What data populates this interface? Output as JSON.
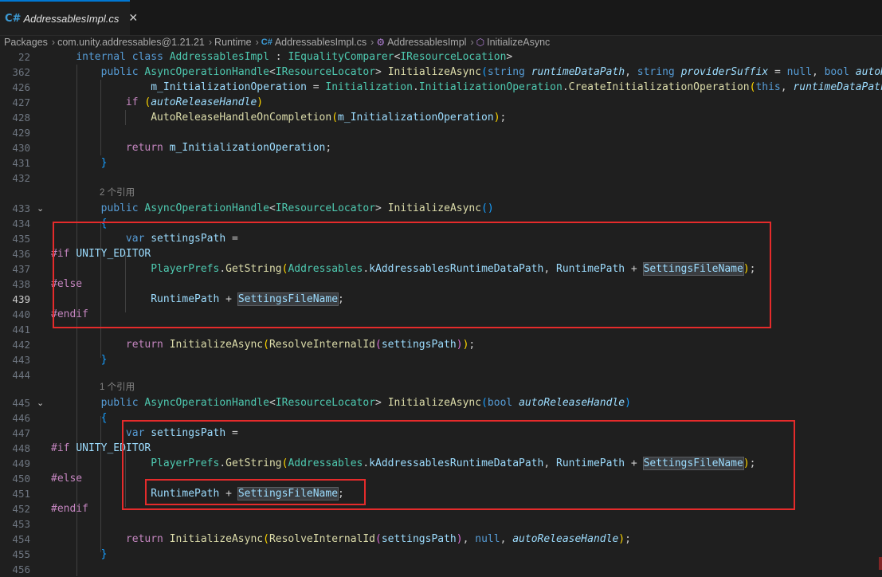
{
  "tab": {
    "icon": "C#",
    "title": "AddressablesImpl.cs",
    "close": "✕"
  },
  "breadcrumb": {
    "items": [
      "Packages",
      "com.unity.addressables@1.21.21",
      "Runtime",
      "AddressablesImpl.cs",
      "AddressablesImpl",
      "InitializeAsync"
    ],
    "separator": "›"
  },
  "code": {
    "ln": {
      "l22": "22",
      "l362": "362",
      "l426": "426",
      "l427": "427",
      "l428": "428",
      "l429": "429",
      "l430": "430",
      "l431": "431",
      "l432": "432",
      "l433": "433",
      "l434": "434",
      "l435": "435",
      "l436": "436",
      "l437": "437",
      "l438": "438",
      "l439": "439",
      "l440": "440",
      "l441": "441",
      "l442": "442",
      "l443": "443",
      "l444": "444",
      "l445": "445",
      "l446": "446",
      "l447": "447",
      "l448": "448",
      "l449": "449",
      "l450": "450",
      "l451": "451",
      "l452": "452",
      "l453": "453",
      "l454": "454",
      "l455": "455",
      "l456": "456"
    },
    "lens1": "2 个引用",
    "lens2": "1 个引用",
    "t": {
      "internal": "internal",
      "class": "class",
      "public": "public",
      "string": "string",
      "null": "null",
      "bool": "bool",
      "this": "this",
      "if": "if",
      "return": "return",
      "var": "var",
      "pp_if": "#if",
      "pp_else": "#else",
      "pp_endif": "#endif",
      "UNITY_EDITOR": "UNITY_EDITOR",
      "AddressablesImpl": "AddressablesImpl",
      "IEqualityComparer": "IEqualityComparer",
      "IResourceLocation": "IResourceLocation",
      "AsyncOperationHandle": "AsyncOperationHandle",
      "IResourceLocator": "IResourceLocator",
      "Initialization": "Initialization",
      "InitializationOperation": "InitializationOperation",
      "PlayerPrefs": "PlayerPrefs",
      "Addressables": "Addressables",
      "InitializeAsync": "InitializeAsync",
      "CreateInitializationOperation": "CreateInitializationOperation",
      "AutoReleaseHandleOnCompletion": "AutoReleaseHandleOnCompletion",
      "GetString": "GetString",
      "ResolveInternalId": "ResolveInternalId",
      "runtimeDataPath": "runtimeDataPath",
      "providerSuffix": "providerSuffix",
      "autoRel": "autoRel",
      "autoReleaseHandle": "autoReleaseHandle",
      "m_InitializationOperation": "m_InitializationOperation",
      "settingsPath": "settingsPath",
      "kAddressablesRuntimeDataPath": "kAddressablesRuntimeDataPath",
      "RuntimePath": "RuntimePath",
      "SettingsFileName": "SettingsFileName"
    }
  }
}
